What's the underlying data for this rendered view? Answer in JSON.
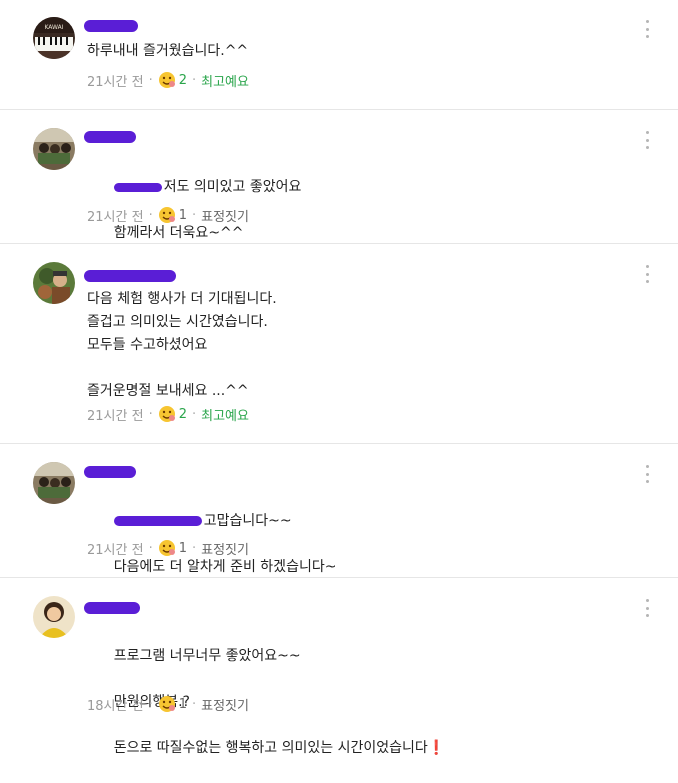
{
  "comments": [
    {
      "lines": [
        "하루내내 즐거웠습니다.^^"
      ],
      "time": "21시간 전",
      "reaction_count": "2",
      "action": "최고예요"
    },
    {
      "line1_rest": "저도 의미있고 좋았어요",
      "line2": "함께라서 더욱요~^^",
      "time": "21시간 전",
      "reaction_count": "1",
      "action": "표정짓기"
    },
    {
      "text": "다음 체험 행사가 더 기대됩니다.\n즐겁고 의미있는 시간였습니다.\n모두들 수고하셨어요\n\n즐거운명절 보내세요 ...^^",
      "time": "21시간 전",
      "reaction_count": "2",
      "action": "최고예요"
    },
    {
      "line1_rest": "고맙습니다~~",
      "line2": "다음에도 더 알차게 준비 하겠습니다~",
      "time": "21시간 전",
      "reaction_count": "1",
      "action": "표정짓기"
    },
    {
      "line1": "프로그램 너무너무 좋았어요~~",
      "line2": "만원의행복.?",
      "line3": "돈으로 따질수없는 행복하고 의미있는 시간이었습니다",
      "line3_emoji": "❗",
      "time": "18시간 전",
      "reaction_count": "1",
      "action": "표정짓기"
    }
  ],
  "separator": "·",
  "colors": {
    "redaction": "#5a1ed6",
    "accent_green": "#2aa54b",
    "meta_gray": "#9a9a9a"
  }
}
